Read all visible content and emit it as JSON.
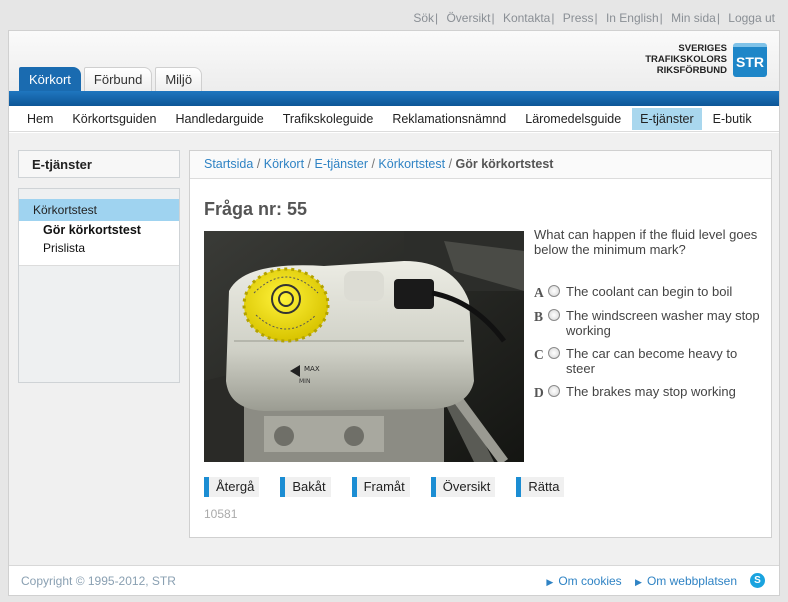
{
  "top_links": [
    "Sök",
    "Översikt",
    "Kontakta",
    "Press",
    "In English",
    "Min sida",
    "Logga ut"
  ],
  "logo": {
    "lines": [
      "SVERIGES",
      "TRAFIKSKOLORS",
      "RIKSFÖRBUND"
    ],
    "mark": "STR"
  },
  "top_tabs": [
    "Körkort",
    "Förbund",
    "Miljö"
  ],
  "main_nav": [
    "Hem",
    "Körkortsguiden",
    "Handledarguide",
    "Trafikskoleguide",
    "Reklamationsnämnd",
    "Läromedelsguide",
    "E-tjänster",
    "E-butik"
  ],
  "sidebar": {
    "title": "E-tjänster",
    "active": "Körkortstest",
    "sub_items": [
      "Gör körkortstest",
      "Prislista"
    ]
  },
  "breadcrumb": {
    "links": [
      "Startsida",
      "Körkort",
      "E-tjänster",
      "Körkortstest"
    ],
    "current": "Gör körkortstest"
  },
  "question": {
    "title": "Fråga nr: 55",
    "text": "What can happen if the fluid level goes below the minimum mark?",
    "answers": [
      {
        "letter": "A",
        "text": "The coolant can begin to boil"
      },
      {
        "letter": "B",
        "text": "The windscreen washer may stop working"
      },
      {
        "letter": "C",
        "text": "The car can become heavy to steer"
      },
      {
        "letter": "D",
        "text": "The brakes may stop working"
      }
    ]
  },
  "buttons": [
    "Återgå",
    "Bakåt",
    "Framåt",
    "Översikt",
    "Rätta"
  ],
  "code": "10581",
  "footer": {
    "copyright": "Copyright © 1995-2012, STR",
    "links": [
      "Om cookies",
      "Om webbplatsen"
    ]
  },
  "colors": {
    "brand_blue": "#1a6bb0",
    "link": "#2f83c4",
    "active_nav": "#a9d7ee"
  }
}
